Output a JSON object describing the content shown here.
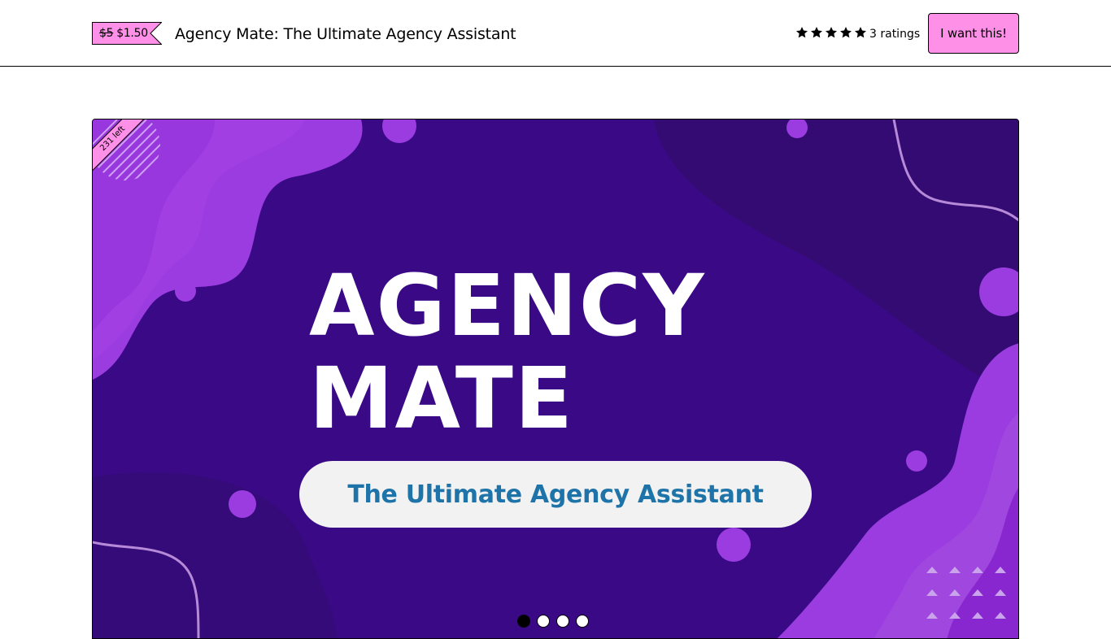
{
  "header": {
    "price_original": "$5",
    "price_current": "$1.50",
    "product_title": "Agency Mate: The Ultimate Agency Assistant",
    "rating_stars": 5,
    "ratings_count_label": "3 ratings",
    "cta_label": "I want this!"
  },
  "carousel": {
    "ribbon_label": "231 left",
    "hero_title_line1": "AGENCY",
    "hero_title_line2": "MATE",
    "hero_tagline": "The Ultimate Agency Assistant",
    "slide_count": 4,
    "active_slide": 1
  },
  "colors": {
    "accent_pink": "#ff90e8",
    "hero_bg": "#3a0a86",
    "hero_wave": "#9b3ce0",
    "tagline_text": "#1e73a8"
  }
}
